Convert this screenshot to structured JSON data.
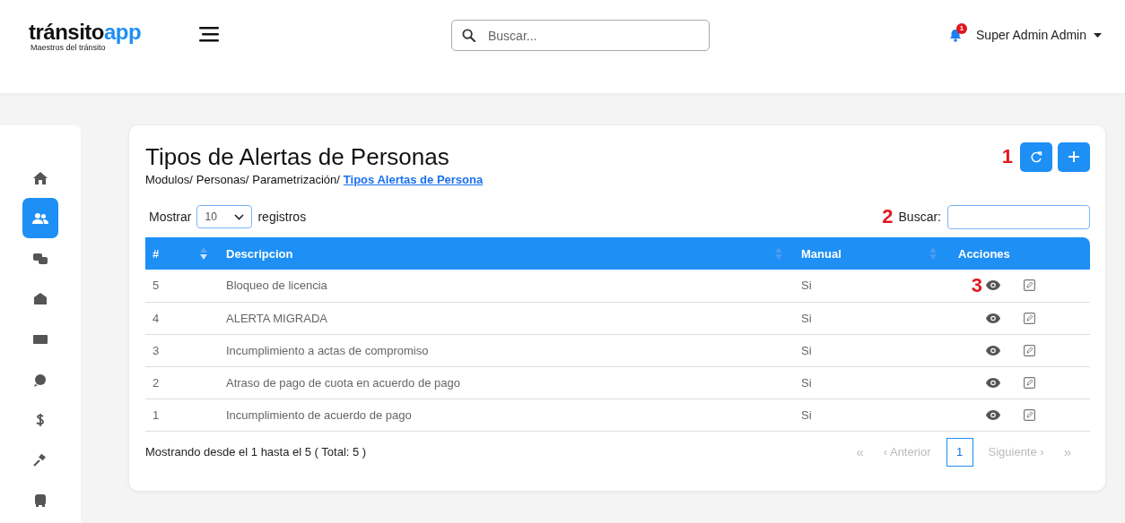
{
  "logo": {
    "main": "tránsito",
    "accent": "app",
    "tagline": "Maestros del tránsito"
  },
  "top_search": {
    "placeholder": "Buscar..."
  },
  "notifications": {
    "count": "1"
  },
  "user": {
    "name": "Super Admin Admin"
  },
  "sidebar": {
    "items": [
      {
        "kind": "home",
        "selected": false
      },
      {
        "kind": "users",
        "selected": true
      },
      {
        "kind": "chat",
        "selected": false
      },
      {
        "kind": "mail",
        "selected": false
      },
      {
        "kind": "card",
        "selected": false
      },
      {
        "kind": "coin",
        "selected": false
      },
      {
        "kind": "dollar",
        "selected": false
      },
      {
        "kind": "gavel",
        "selected": false
      },
      {
        "kind": "bus",
        "selected": false
      }
    ]
  },
  "page": {
    "title": "Tipos de Alertas de Personas",
    "breadcrumb": [
      "Modulos/",
      "Personas/",
      "Parametrización/"
    ],
    "breadcrumb_current": "Tipos Alertas de Persona"
  },
  "actions": {
    "annotation": "1",
    "buttons": [
      {
        "kind": "refresh"
      },
      {
        "kind": "add"
      }
    ]
  },
  "length": {
    "label_before": "Mostrar",
    "value": "10",
    "label_after": "registros"
  },
  "filter": {
    "annotation": "2",
    "label": "Buscar:"
  },
  "table": {
    "columns": [
      {
        "label": "#",
        "sortable": true,
        "sorted": true
      },
      {
        "label": "Descripcion",
        "sortable": true,
        "sorted": false
      },
      {
        "label": "Manual",
        "sortable": true,
        "sorted": false
      },
      {
        "label": "Acciones",
        "sortable": false
      }
    ],
    "rows": [
      {
        "id": "5",
        "description": "Bloqueo de licencia",
        "manual": "Si",
        "annotation": "3"
      },
      {
        "id": "4",
        "description": "ALERTA MIGRADA",
        "manual": "Si"
      },
      {
        "id": "3",
        "description": "Incumplimiento a actas de compromiso",
        "manual": "Si"
      },
      {
        "id": "2",
        "description": "Atraso de pago de cuota en acuerdo de pago",
        "manual": "Si"
      },
      {
        "id": "1",
        "description": "Incumplimiento de acuerdo de pago",
        "manual": "Si"
      }
    ]
  },
  "info": "Mostrando desde el 1 hasta el 5 ( Total: 5 )",
  "pagination": [
    {
      "kind": "first",
      "label": "«",
      "disabled": true,
      "selected": false
    },
    {
      "kind": "prev",
      "label": "‹ Anterior",
      "disabled": true,
      "selected": false
    },
    {
      "kind": "page",
      "label": "1",
      "disabled": false,
      "selected": true
    },
    {
      "kind": "next",
      "label": "Siguiente ›",
      "disabled": true,
      "selected": false
    },
    {
      "kind": "last",
      "label": "»",
      "disabled": true,
      "selected": false
    }
  ]
}
